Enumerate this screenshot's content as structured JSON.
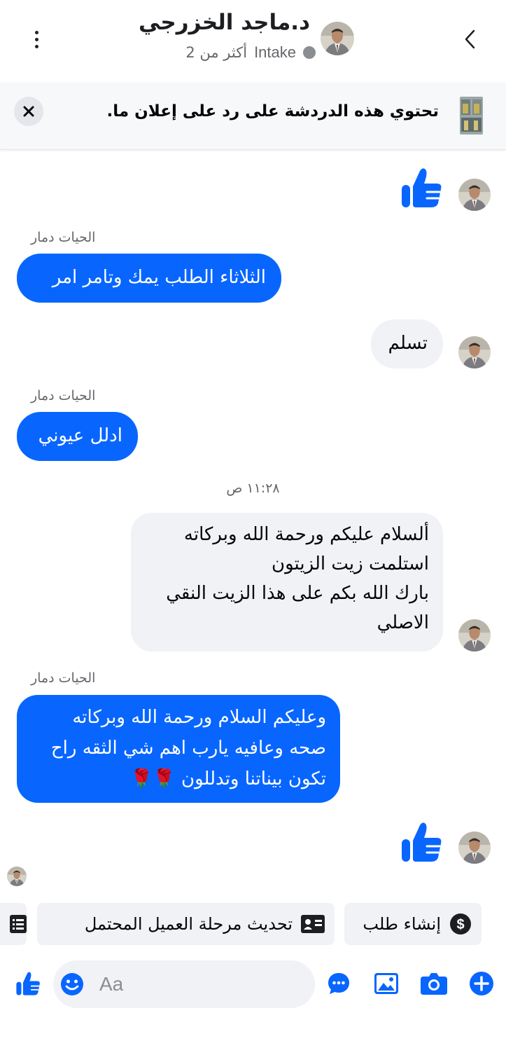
{
  "header": {
    "contact_name": "د.ماجد الخزرجي",
    "pipeline_label": "Intake",
    "pipeline_count": "أكثر من 2",
    "back_icon": "chevron-left-icon",
    "menu_icon": "more-vertical-icon"
  },
  "ad_banner": {
    "text": "تحتوي هذه الدردشة على رد على إعلان ما."
  },
  "messages": [
    {
      "sender": "contact",
      "type": "like"
    },
    {
      "sender": "page",
      "sender_label": "الحيات دمار",
      "text": "الثلاثاء الطلب يمك وتامر امر"
    },
    {
      "sender": "contact",
      "text": "تسلم"
    },
    {
      "sender": "page",
      "sender_label": "الحيات دمار",
      "text": "ادلل عيوني"
    },
    {
      "type": "timestamp",
      "text": "١١:٢٨ ص"
    },
    {
      "sender": "contact",
      "lines": [
        "ألسلام عليكم ورحمة الله وبركاته",
        "استلمت زيت الزيتون",
        "بارك الله بكم على هذا الزيت النقي",
        "الاصلي"
      ]
    },
    {
      "sender": "page",
      "sender_label": "الحيات دمار",
      "lines": [
        "وعليكم السلام ورحمة الله وبركاته",
        "صحه وعافيه يارب اهم شي الثقه راح",
        "تكون بيناتنا وتدللون 🌹🌹"
      ]
    },
    {
      "sender": "contact",
      "type": "like"
    }
  ],
  "quick_actions": [
    {
      "label": "إنشاء طلب",
      "icon": "dollar-circle-icon"
    },
    {
      "label": "تحديث مرحلة العميل المحتمل",
      "icon": "contact-card-icon"
    },
    {
      "label": "",
      "icon": "list-icon"
    }
  ],
  "composer": {
    "placeholder": "Aa",
    "value": ""
  },
  "colors": {
    "accent": "#0866ff",
    "incoming_bubble": "#f0f2f5",
    "secondary_text": "#65676b"
  }
}
